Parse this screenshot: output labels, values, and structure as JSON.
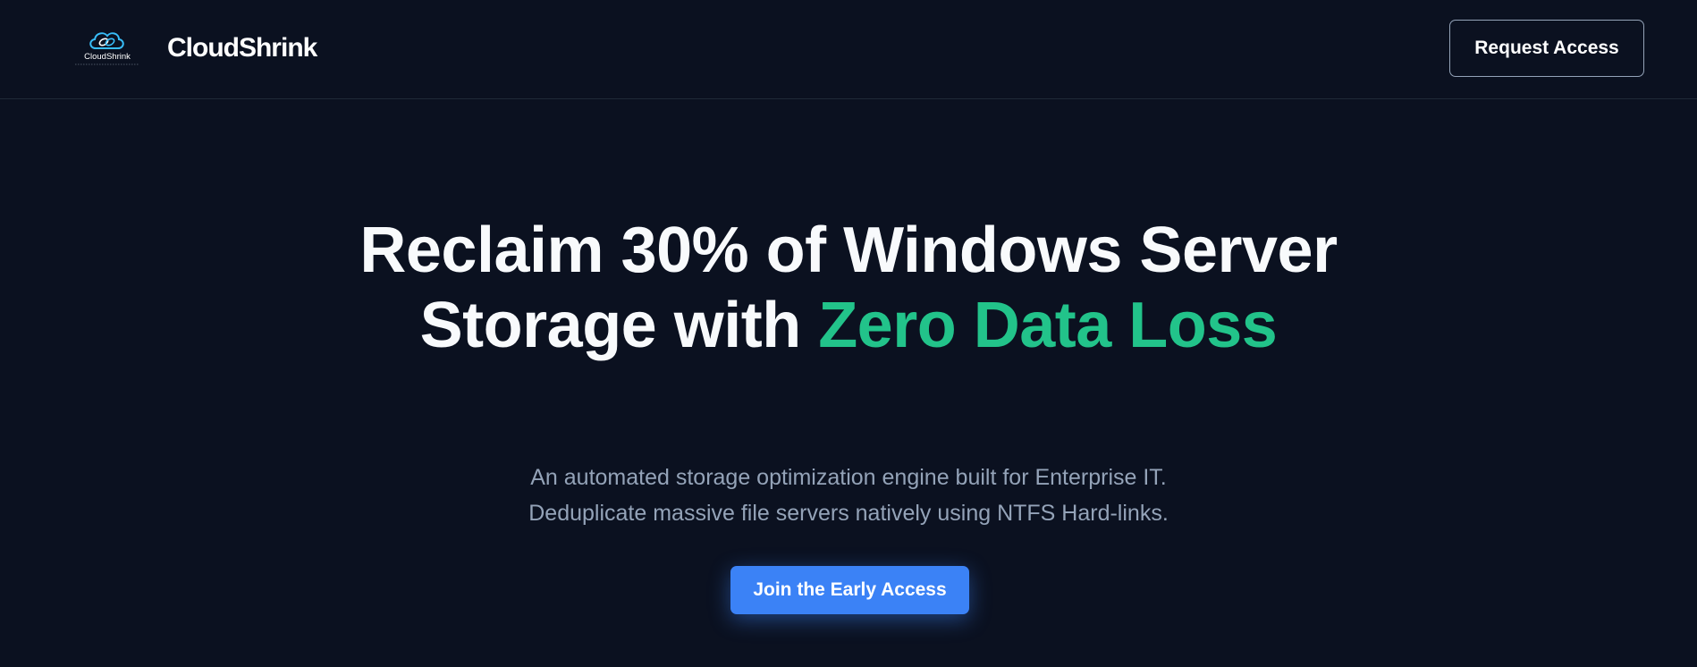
{
  "navbar": {
    "logo_icon": "cloud-link-icon",
    "logo_text": "CloudShrink",
    "brand_name": "CloudShrink",
    "request_access_label": "Request Access"
  },
  "hero": {
    "title_part1": "Reclaim 30% of Windows Server Storage with ",
    "title_accent": "Zero Data Loss",
    "subtitle_line1": "An automated storage optimization engine built for Enterprise IT.",
    "subtitle_line2": "Deduplicate massive file servers natively using NTFS Hard-links.",
    "cta_label": "Join the Early Access"
  },
  "colors": {
    "background": "#0b1120",
    "accent_green": "#22c38a",
    "primary_blue": "#3b82f6",
    "muted_text": "#94a3b8"
  }
}
